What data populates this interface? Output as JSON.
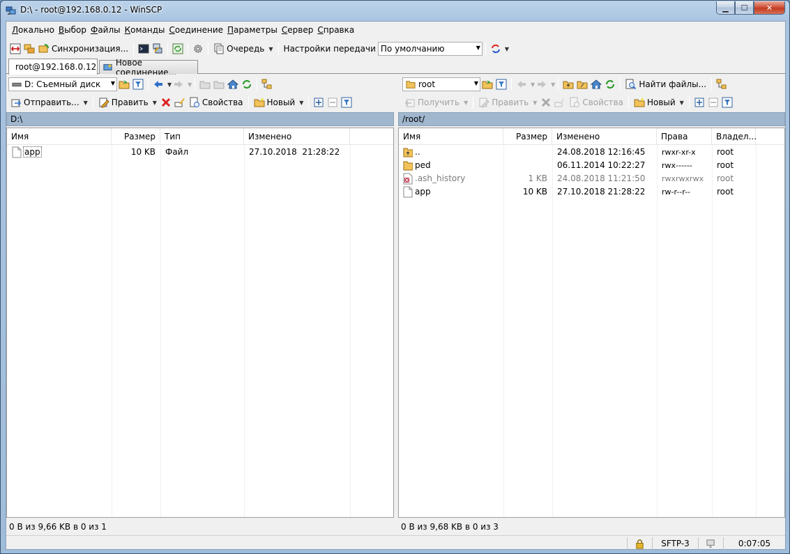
{
  "window": {
    "title": "D:\\ - root@192.168.0.12 - WinSCP"
  },
  "menu": [
    {
      "label": "Локально",
      "key": "Л",
      "rest": "окально"
    },
    {
      "label": "Выбор",
      "key": "В",
      "rest": "ыбор"
    },
    {
      "label": "Файлы",
      "key": "Ф",
      "rest": "айлы"
    },
    {
      "label": "Команды",
      "key": "К",
      "rest": "оманды"
    },
    {
      "label": "Соединение",
      "key": "С",
      "rest": "оединение"
    },
    {
      "label": "Параметры",
      "key": "П",
      "rest": "араметры"
    },
    {
      "label": "Сервер",
      "key": "С",
      "rest": "ервер"
    },
    {
      "label": "Справка",
      "key": "С",
      "rest": "правка"
    }
  ],
  "toolbar": {
    "sync_label": "Синхронизация...",
    "queue_label": "Очередь",
    "transfer_settings_label": "Настройки передачи",
    "transfer_preset": "По умолчанию"
  },
  "tabs": [
    {
      "label": "root@192.168.0.12",
      "active": true
    },
    {
      "label": "Новое соединение...",
      "active": false
    }
  ],
  "left": {
    "drive": "D: Съемный диск",
    "send_label": "Отправить...",
    "edit_label": "Править",
    "props_label": "Свойства",
    "new_label": "Новый",
    "path": "D:\\",
    "columns": [
      "Имя",
      "Размер",
      "Тип",
      "Изменено"
    ],
    "files": [
      {
        "name": "app",
        "size": "10 KB",
        "type": "Файл",
        "modified": "27.10.2018  21:28:22"
      }
    ],
    "status": "0 B из 9,66 KB в 0 из 1"
  },
  "right": {
    "dir": "root",
    "find_label": "Найти файлы...",
    "get_label": "Получить",
    "edit_label": "Править",
    "props_label": "Свойства",
    "new_label": "Новый",
    "path": "/root/",
    "columns": [
      "Имя",
      "Размер",
      "Изменено",
      "Права",
      "Владел..."
    ],
    "files": [
      {
        "name": "..",
        "size": "",
        "modified": "24.08.2018 12:16:45",
        "rights": "rwxr-xr-x",
        "owner": "root",
        "icon": "parent",
        "dim": false
      },
      {
        "name": "ped",
        "size": "",
        "modified": "06.11.2014 10:22:27",
        "rights": "rwx------",
        "owner": "root",
        "icon": "folder",
        "dim": false
      },
      {
        "name": ".ash_history",
        "size": "1 KB",
        "modified": "24.08.2018 11:21:50",
        "rights": "rwxrwxrwx",
        "owner": "root",
        "icon": "hidden",
        "dim": true
      },
      {
        "name": "app",
        "size": "10 KB",
        "modified": "27.10.2018 21:28:22",
        "rights": "rw-r--r--",
        "owner": "root",
        "icon": "file",
        "dim": false
      }
    ],
    "status": "0 B из 9,68 KB в 0 из 3"
  },
  "statusbar": {
    "protocol": "SFTP-3",
    "time": "0:07:05"
  },
  "colors": {
    "path_bar": "#a0b7ce",
    "title_gradient": "#a9c4e0"
  }
}
